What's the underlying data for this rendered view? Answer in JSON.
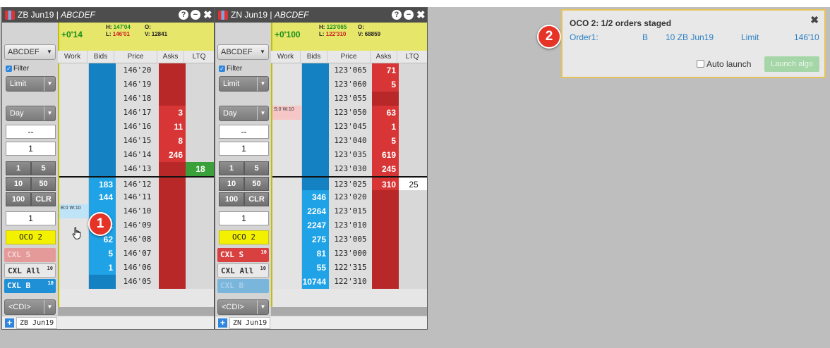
{
  "ladders": [
    {
      "title_symbol": "ZB Jun19",
      "title_account": "ABCDEF",
      "header": {
        "change": "+0'14",
        "high": "147'04",
        "low": "146'01",
        "open": "",
        "volume": "12841"
      },
      "sidebar": {
        "account": "ABCDEF",
        "filter": "Filter",
        "order_type": "Limit",
        "tif": "Day",
        "price_field": "--",
        "qty_field": "1",
        "qty_buttons": [
          "1",
          "5",
          "10",
          "50",
          "100",
          "CLR"
        ],
        "qty_value": "1",
        "oco": "OCO 2",
        "cxl_s": "CXL S",
        "cxl_all": "CXL All",
        "cxl_all_count": "10",
        "cxl_b": "CXL B",
        "cxl_b_count": "10",
        "cdi": "<CDI>"
      },
      "columns": [
        "Work",
        "Bids",
        "Price",
        "Asks",
        "LTQ"
      ],
      "rows": [
        {
          "work": "",
          "bid": "",
          "price": "146'20",
          "ask": "",
          "ltq": ""
        },
        {
          "work": "",
          "bid": "",
          "price": "146'19",
          "ask": "",
          "ltq": ""
        },
        {
          "work": "",
          "bid": "",
          "price": "146'18",
          "ask": "",
          "ltq": ""
        },
        {
          "work": "",
          "bid": "",
          "price": "146'17",
          "ask": "3",
          "ltq": ""
        },
        {
          "work": "",
          "bid": "",
          "price": "146'16",
          "ask": "11",
          "ltq": ""
        },
        {
          "work": "",
          "bid": "",
          "price": "146'15",
          "ask": "8",
          "ltq": ""
        },
        {
          "work": "",
          "bid": "",
          "price": "146'14",
          "ask": "246",
          "ltq": ""
        },
        {
          "work": "",
          "bid": "",
          "price": "146'13",
          "ask": "",
          "ltq": "18"
        },
        {
          "work": "",
          "bid": "183",
          "price": "146'12",
          "ask": "",
          "ltq": ""
        },
        {
          "work": "",
          "bid": "144",
          "price": "146'11",
          "ask": "",
          "ltq": ""
        },
        {
          "work": "B:0 W:10",
          "bid": "",
          "price": "146'10",
          "ask": "",
          "ltq": ""
        },
        {
          "work": "",
          "bid": "202",
          "price": "146'09",
          "ask": "",
          "ltq": ""
        },
        {
          "work": "",
          "bid": "62",
          "price": "146'08",
          "ask": "",
          "ltq": ""
        },
        {
          "work": "",
          "bid": "5",
          "price": "146'07",
          "ask": "",
          "ltq": ""
        },
        {
          "work": "",
          "bid": "1",
          "price": "146'06",
          "ask": "",
          "ltq": ""
        },
        {
          "work": "",
          "bid": "",
          "price": "146'05",
          "ask": "",
          "ltq": ""
        }
      ],
      "footer_tab": "ZB Jun19"
    },
    {
      "title_symbol": "ZN Jun19",
      "title_account": "ABCDEF",
      "header": {
        "change": "+0'100",
        "high": "123'065",
        "low": "122'310",
        "open": "",
        "volume": "68859"
      },
      "sidebar": {
        "account": "ABCDEF",
        "filter": "Filter",
        "order_type": "Limit",
        "tif": "Day",
        "price_field": "--",
        "qty_field": "1",
        "qty_buttons": [
          "1",
          "5",
          "10",
          "50",
          "100",
          "CLR"
        ],
        "qty_value": "1",
        "oco": "OCO 2",
        "cxl_s": "CXL S",
        "cxl_s_count": "10",
        "cxl_all": "CXL All",
        "cxl_all_count": "10",
        "cxl_b": "CXL B",
        "cdi": "<CDI>"
      },
      "columns": [
        "Work",
        "Bids",
        "Price",
        "Asks",
        "LTQ"
      ],
      "rows": [
        {
          "work": "",
          "bid": "",
          "price": "123'065",
          "ask": "71",
          "ltq": ""
        },
        {
          "work": "",
          "bid": "",
          "price": "123'060",
          "ask": "5",
          "ltq": ""
        },
        {
          "work": "",
          "bid": "",
          "price": "123'055",
          "ask": "",
          "ltq": ""
        },
        {
          "work": "S:0 W:10",
          "bid": "",
          "price": "123'050",
          "ask": "63",
          "ltq": ""
        },
        {
          "work": "",
          "bid": "",
          "price": "123'045",
          "ask": "1",
          "ltq": ""
        },
        {
          "work": "",
          "bid": "",
          "price": "123'040",
          "ask": "5",
          "ltq": ""
        },
        {
          "work": "",
          "bid": "",
          "price": "123'035",
          "ask": "619",
          "ltq": ""
        },
        {
          "work": "",
          "bid": "",
          "price": "123'030",
          "ask": "245",
          "ltq": ""
        },
        {
          "work": "",
          "bid": "",
          "price": "123'025",
          "ask": "310",
          "ltq": "25"
        },
        {
          "work": "",
          "bid": "346",
          "price": "123'020",
          "ask": "",
          "ltq": ""
        },
        {
          "work": "",
          "bid": "2264",
          "price": "123'015",
          "ask": "",
          "ltq": ""
        },
        {
          "work": "",
          "bid": "2247",
          "price": "123'010",
          "ask": "",
          "ltq": ""
        },
        {
          "work": "",
          "bid": "275",
          "price": "123'005",
          "ask": "",
          "ltq": ""
        },
        {
          "work": "",
          "bid": "81",
          "price": "123'000",
          "ask": "",
          "ltq": ""
        },
        {
          "work": "",
          "bid": "55",
          "price": "122'315",
          "ask": "",
          "ltq": ""
        },
        {
          "work": "",
          "bid": "10744",
          "price": "122'310",
          "ask": "",
          "ltq": ""
        }
      ],
      "footer_tab": "ZN Jun19"
    }
  ],
  "callouts": [
    "1",
    "2"
  ],
  "oco_panel": {
    "title": "OCO 2: 1/2 orders staged",
    "order_label": "Order1:",
    "side": "B",
    "qty_symbol": "10 ZB Jun19",
    "type": "Limit",
    "price": "146'10",
    "auto_launch": "Auto launch",
    "launch_button": "Launch algo"
  },
  "colors": {
    "bid": "#1381c2",
    "ask": "#b82828",
    "header": "#e5e66a",
    "ltq_green": "#3aa13a",
    "oco_button": "#f3f000",
    "panel_border": "#e6c25a"
  }
}
